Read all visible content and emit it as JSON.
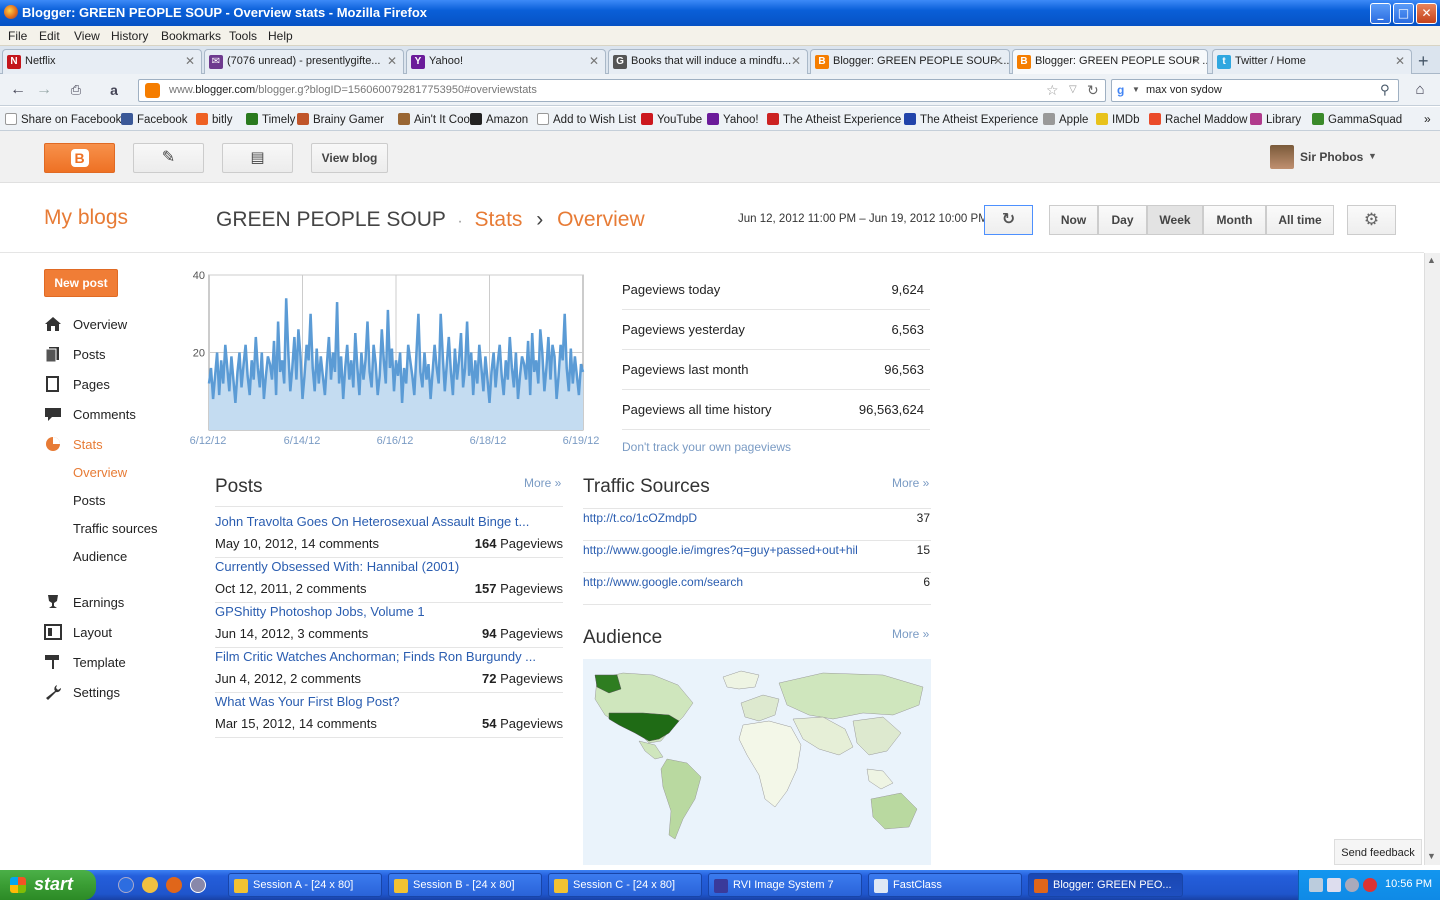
{
  "window": {
    "title": "Blogger: GREEN PEOPLE SOUP - Overview stats - Mozilla Firefox",
    "min": "_",
    "max": "□",
    "close": "✕"
  },
  "menu": [
    "File",
    "Edit",
    "View",
    "History",
    "Bookmarks",
    "Tools",
    "Help"
  ],
  "tabs": [
    {
      "label": "Netflix",
      "color": "#c4161c",
      "glyph": "N"
    },
    {
      "label": "(7076 unread) - presentlygifte...",
      "color": "#6e3a8e",
      "glyph": "✉"
    },
    {
      "label": "Yahoo!",
      "color": "#6b1b9a",
      "glyph": "Y"
    },
    {
      "label": "Books that will induce a mindfu...",
      "color": "#555555",
      "glyph": "G"
    },
    {
      "label": "Blogger: GREEN PEOPLE SOUP ...",
      "color": "#f57d00",
      "glyph": "B"
    },
    {
      "label": "Blogger: GREEN PEOPLE SOUP ...",
      "color": "#f57d00",
      "glyph": "B"
    },
    {
      "label": "Twitter / Home",
      "color": "#2fa7e0",
      "glyph": "t"
    }
  ],
  "tab_close": "✕",
  "new_tab": "+",
  "url": {
    "prefix": "www.",
    "domain": "blogger.com",
    "rest": "/blogger.g?blogID=1560600792817753950#overviewstats"
  },
  "search": {
    "value": "max von sydow"
  },
  "bookmarks": [
    {
      "label": "Share on Facebook",
      "color": "#ffffff"
    },
    {
      "label": "Facebook",
      "color": "#3b5998"
    },
    {
      "label": "bitly",
      "color": "#ee6123"
    },
    {
      "label": "Timely",
      "color": "#2a7a1e"
    },
    {
      "label": "Brainy Gamer",
      "color": "#c0552a"
    },
    {
      "label": "Ain't It Cool",
      "color": "#996633"
    },
    {
      "label": "Amazon",
      "color": "#222222"
    },
    {
      "label": "Add to Wish List",
      "color": "#ffffff"
    },
    {
      "label": "YouTube",
      "color": "#cc181e"
    },
    {
      "label": "Yahoo!",
      "color": "#6b1b9a"
    },
    {
      "label": "The Atheist Experience",
      "color": "#cc2222"
    },
    {
      "label": "The Atheist Experience",
      "color": "#2244aa"
    },
    {
      "label": "Apple",
      "color": "#999999"
    },
    {
      "label": "IMDb",
      "color": "#e8c21b"
    },
    {
      "label": "Rachel Maddow",
      "color": "#ea4b2a"
    },
    {
      "label": "Library",
      "color": "#b03a8c"
    },
    {
      "label": "GammaSquad",
      "color": "#3a8a2a"
    }
  ],
  "bookmarks_more": "»",
  "blogger": {
    "view_blog": "View blog",
    "user": "Sir Phobos",
    "my_blogs": "My blogs",
    "blog_name": "GREEN PEOPLE SOUP",
    "crumb_dot": "·",
    "crumb_stats": "Stats",
    "crumb_arrow": "›",
    "crumb_overview": "Overview",
    "date_range": "Jun 12, 2012 11:00 PM – Jun 19, 2012 10:00 PM",
    "ranges": [
      "Now",
      "Day",
      "Week",
      "Month",
      "All time"
    ],
    "selected_range": "Week",
    "new_post": "New post"
  },
  "sidebar": [
    {
      "label": "Overview",
      "icon": "home-icon"
    },
    {
      "label": "Posts",
      "icon": "posts-icon"
    },
    {
      "label": "Pages",
      "icon": "pages-icon"
    },
    {
      "label": "Comments",
      "icon": "comments-icon"
    },
    {
      "label": "Stats",
      "icon": "stats-pie-icon"
    }
  ],
  "stats_sub": [
    "Overview",
    "Posts",
    "Traffic sources",
    "Audience"
  ],
  "sidebar2": [
    {
      "label": "Earnings",
      "icon": "trophy-icon"
    },
    {
      "label": "Layout",
      "icon": "layout-icon"
    },
    {
      "label": "Template",
      "icon": "paint-roller-icon"
    },
    {
      "label": "Settings",
      "icon": "wrench-icon"
    }
  ],
  "chart_data": {
    "type": "area",
    "yticks": [
      "40",
      "20"
    ],
    "ylim": [
      0,
      40
    ],
    "xticks": [
      "6/12/12",
      "6/14/12",
      "6/16/12",
      "6/18/12",
      "6/19/12"
    ],
    "color": "#5b9bd5",
    "values": [
      12,
      16,
      8,
      14,
      20,
      9,
      18,
      12,
      22,
      16,
      10,
      19,
      13,
      7,
      15,
      20,
      11,
      17,
      22,
      14,
      9,
      18,
      13,
      24,
      16,
      11,
      20,
      8,
      14,
      19,
      17,
      13,
      23,
      9,
      28,
      15,
      18,
      12,
      34,
      20,
      10,
      16,
      24,
      13,
      26,
      19,
      8,
      14,
      22,
      18,
      30,
      16,
      10,
      21,
      12,
      19,
      14,
      9,
      17,
      24,
      13,
      20,
      15,
      33,
      12,
      19,
      8,
      16,
      22,
      13,
      18,
      11,
      25,
      16,
      9,
      20,
      13,
      18,
      28,
      15,
      11,
      22,
      17,
      9,
      14,
      26,
      18,
      12,
      31,
      16,
      21,
      10,
      18,
      14,
      20,
      7,
      16,
      12,
      22,
      18,
      14,
      9,
      19,
      30,
      15,
      11,
      20,
      13,
      17,
      8,
      15,
      22,
      16,
      12,
      30,
      19,
      10,
      17,
      24,
      15,
      9,
      21,
      13,
      18,
      25,
      11,
      16,
      28,
      14,
      20,
      9,
      18,
      12,
      22,
      16,
      10,
      19,
      13,
      7,
      15,
      20,
      11,
      17,
      22,
      14,
      9,
      18,
      13,
      24,
      16,
      11,
      20,
      8,
      14,
      19,
      17,
      13,
      23,
      9,
      25,
      15,
      18,
      12,
      26,
      20,
      10,
      16,
      24,
      13,
      22,
      19,
      8,
      14,
      22,
      18,
      30,
      16,
      10,
      21,
      12,
      19,
      14,
      9,
      17,
      15
    ]
  },
  "pageviews": [
    {
      "label": "Pageviews today",
      "value": "9,624"
    },
    {
      "label": "Pageviews yesterday",
      "value": "6,563"
    },
    {
      "label": "Pageviews last month",
      "value": "96,563"
    },
    {
      "label": "Pageviews all time history",
      "value": "96,563,624"
    }
  ],
  "dont_track": "Don't track your own pageviews",
  "posts_section": {
    "title": "Posts",
    "more": "More »",
    "items": [
      {
        "title": "John Travolta Goes On Heterosexual Assault Binge t...",
        "meta": "May 10, 2012, 14 comments",
        "views": "164",
        "unit": "Pageviews"
      },
      {
        "title": "Currently Obsessed With: Hannibal (2001)",
        "meta": "Oct 12, 2011, 2 comments",
        "views": "157",
        "unit": "Pageviews"
      },
      {
        "title": "GPShitty Photoshop Jobs, Volume 1",
        "meta": "Jun 14, 2012, 3 comments",
        "views": "94",
        "unit": "Pageviews"
      },
      {
        "title": "Film Critic Watches Anchorman; Finds Ron Burgundy ...",
        "meta": "Jun 4, 2012, 2 comments",
        "views": "72",
        "unit": "Pageviews"
      },
      {
        "title": "What Was Your First Blog Post?",
        "meta": "Mar 15, 2012, 14 comments",
        "views": "54",
        "unit": "Pageviews"
      }
    ]
  },
  "traffic": {
    "title": "Traffic Sources",
    "more": "More »",
    "items": [
      {
        "url": "http://t.co/1cOZmdpD",
        "count": "37"
      },
      {
        "url": "http://www.google.ie/imgres?q=guy+passed+out+hil",
        "count": "15"
      },
      {
        "url": "http://www.google.com/search",
        "count": "6"
      }
    ]
  },
  "audience": {
    "title": "Audience",
    "more": "More »"
  },
  "feedback": "Send feedback",
  "taskbar": {
    "start": "start",
    "items": [
      {
        "label": "Session A - [24 x 80]",
        "color": "#f2c232"
      },
      {
        "label": "Session B - [24 x 80]",
        "color": "#f2c232"
      },
      {
        "label": "Session C - [24 x 80]",
        "color": "#f2c232"
      },
      {
        "label": "RVI Image System 7",
        "color": "#3a3a9a"
      },
      {
        "label": "FastClass",
        "color": "#dfe8f5"
      },
      {
        "label": "Blogger: GREEN PEO...",
        "color": "#e0661a"
      }
    ],
    "time": "10:56 PM"
  }
}
